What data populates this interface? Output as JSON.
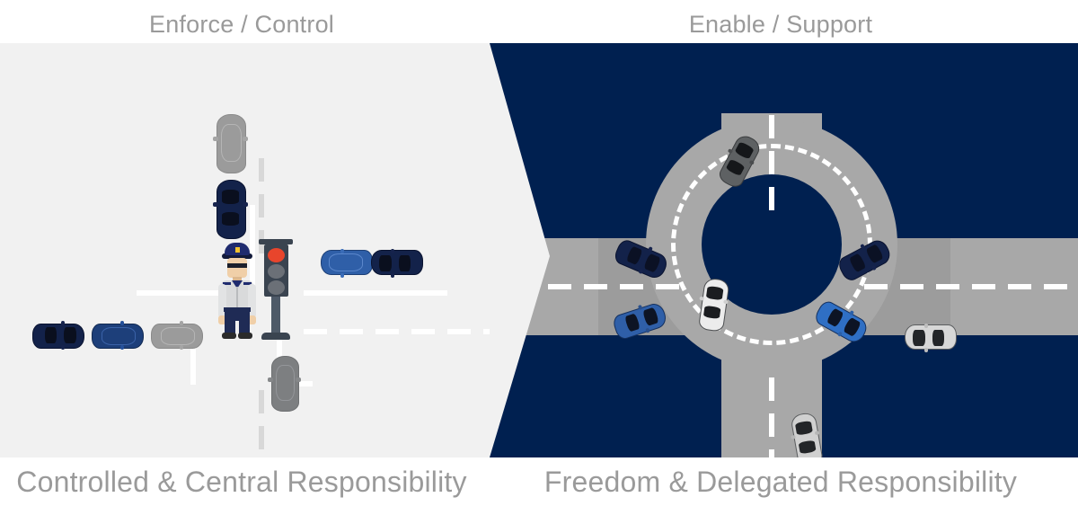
{
  "headers": {
    "top_left": "Enforce / Control",
    "top_right": "Enable / Support",
    "bottom_left": "Controlled & Central Responsibility",
    "bottom_right": "Freedom & Delegated Responsibility"
  },
  "colors": {
    "navy": "#002050",
    "light_panel": "#f1f1f1",
    "caption_text": "#9a9a9a",
    "road_gray": "#a8a8a8",
    "road_gray_dark": "#9c9c9c",
    "lane_marking": "#ffffff",
    "car_navy": "#13224a",
    "car_blue": "#2f5fa8",
    "car_blue_dark": "#1d3f7a",
    "car_gray": "#9b9b9b",
    "car_dark_gray": "#5e6163",
    "car_white": "#ececec",
    "traffic_light_red": "#e8452c",
    "traffic_light_off": "#6b7077",
    "traffic_light_case": "#3a4450",
    "uniform_shirt": "#d9dadb",
    "uniform_trousers": "#1f2b55",
    "uniform_cap": "#1f2b6e",
    "skin": "#f0cfa8"
  },
  "left_scene": {
    "name": "controlled-intersection",
    "description": "Signalised crossroads with a police officer directing traffic and a red traffic light; queued cars wait on every approach.",
    "officer": {
      "name": "police-officer",
      "cap_badge_color": "#f2c230",
      "sunglasses": true
    },
    "traffic_light": {
      "name": "traffic-light",
      "lamps": [
        "red",
        "off",
        "off"
      ],
      "active_lamp": "red"
    },
    "cars": [
      {
        "id": "left-queue-1",
        "color": "#13224a",
        "orientation": "horizontal"
      },
      {
        "id": "left-queue-2",
        "color": "#1d3f7a",
        "orientation": "horizontal"
      },
      {
        "id": "left-queue-3",
        "color": "#9b9b9b",
        "orientation": "horizontal"
      },
      {
        "id": "north-queue-1",
        "color": "#9b9b9b",
        "orientation": "vertical"
      },
      {
        "id": "north-queue-2",
        "color": "#13224a",
        "orientation": "vertical"
      },
      {
        "id": "south-queue-1",
        "color": "#7d7f81",
        "orientation": "vertical"
      },
      {
        "id": "right-queue-1",
        "color": "#2f5fa8",
        "orientation": "horizontal"
      },
      {
        "id": "right-queue-2",
        "color": "#13224a",
        "orientation": "horizontal"
      }
    ]
  },
  "right_scene": {
    "name": "roundabout",
    "description": "Four-arm roundabout with dashed circulatory lane markings; cars flow freely without signals.",
    "arms": [
      "north",
      "south",
      "east",
      "west"
    ],
    "cars": [
      {
        "id": "rb-north-approach",
        "color": "#5e6163",
        "orientation": "diagonal"
      },
      {
        "id": "rb-west-upper",
        "color": "#13224a",
        "orientation": "diagonal"
      },
      {
        "id": "rb-west-lower",
        "color": "#2f5fa8",
        "orientation": "diagonal"
      },
      {
        "id": "rb-inner-west",
        "color": "#ececec",
        "orientation": "vertical"
      },
      {
        "id": "rb-east-upper",
        "color": "#13224a",
        "orientation": "diagonal"
      },
      {
        "id": "rb-east-lower",
        "color": "#2f5fa8",
        "orientation": "diagonal"
      },
      {
        "id": "rb-east-exit",
        "color": "#d7d7d7",
        "orientation": "horizontal"
      },
      {
        "id": "rb-south-approach",
        "color": "#d0d0d0",
        "orientation": "vertical"
      }
    ]
  }
}
